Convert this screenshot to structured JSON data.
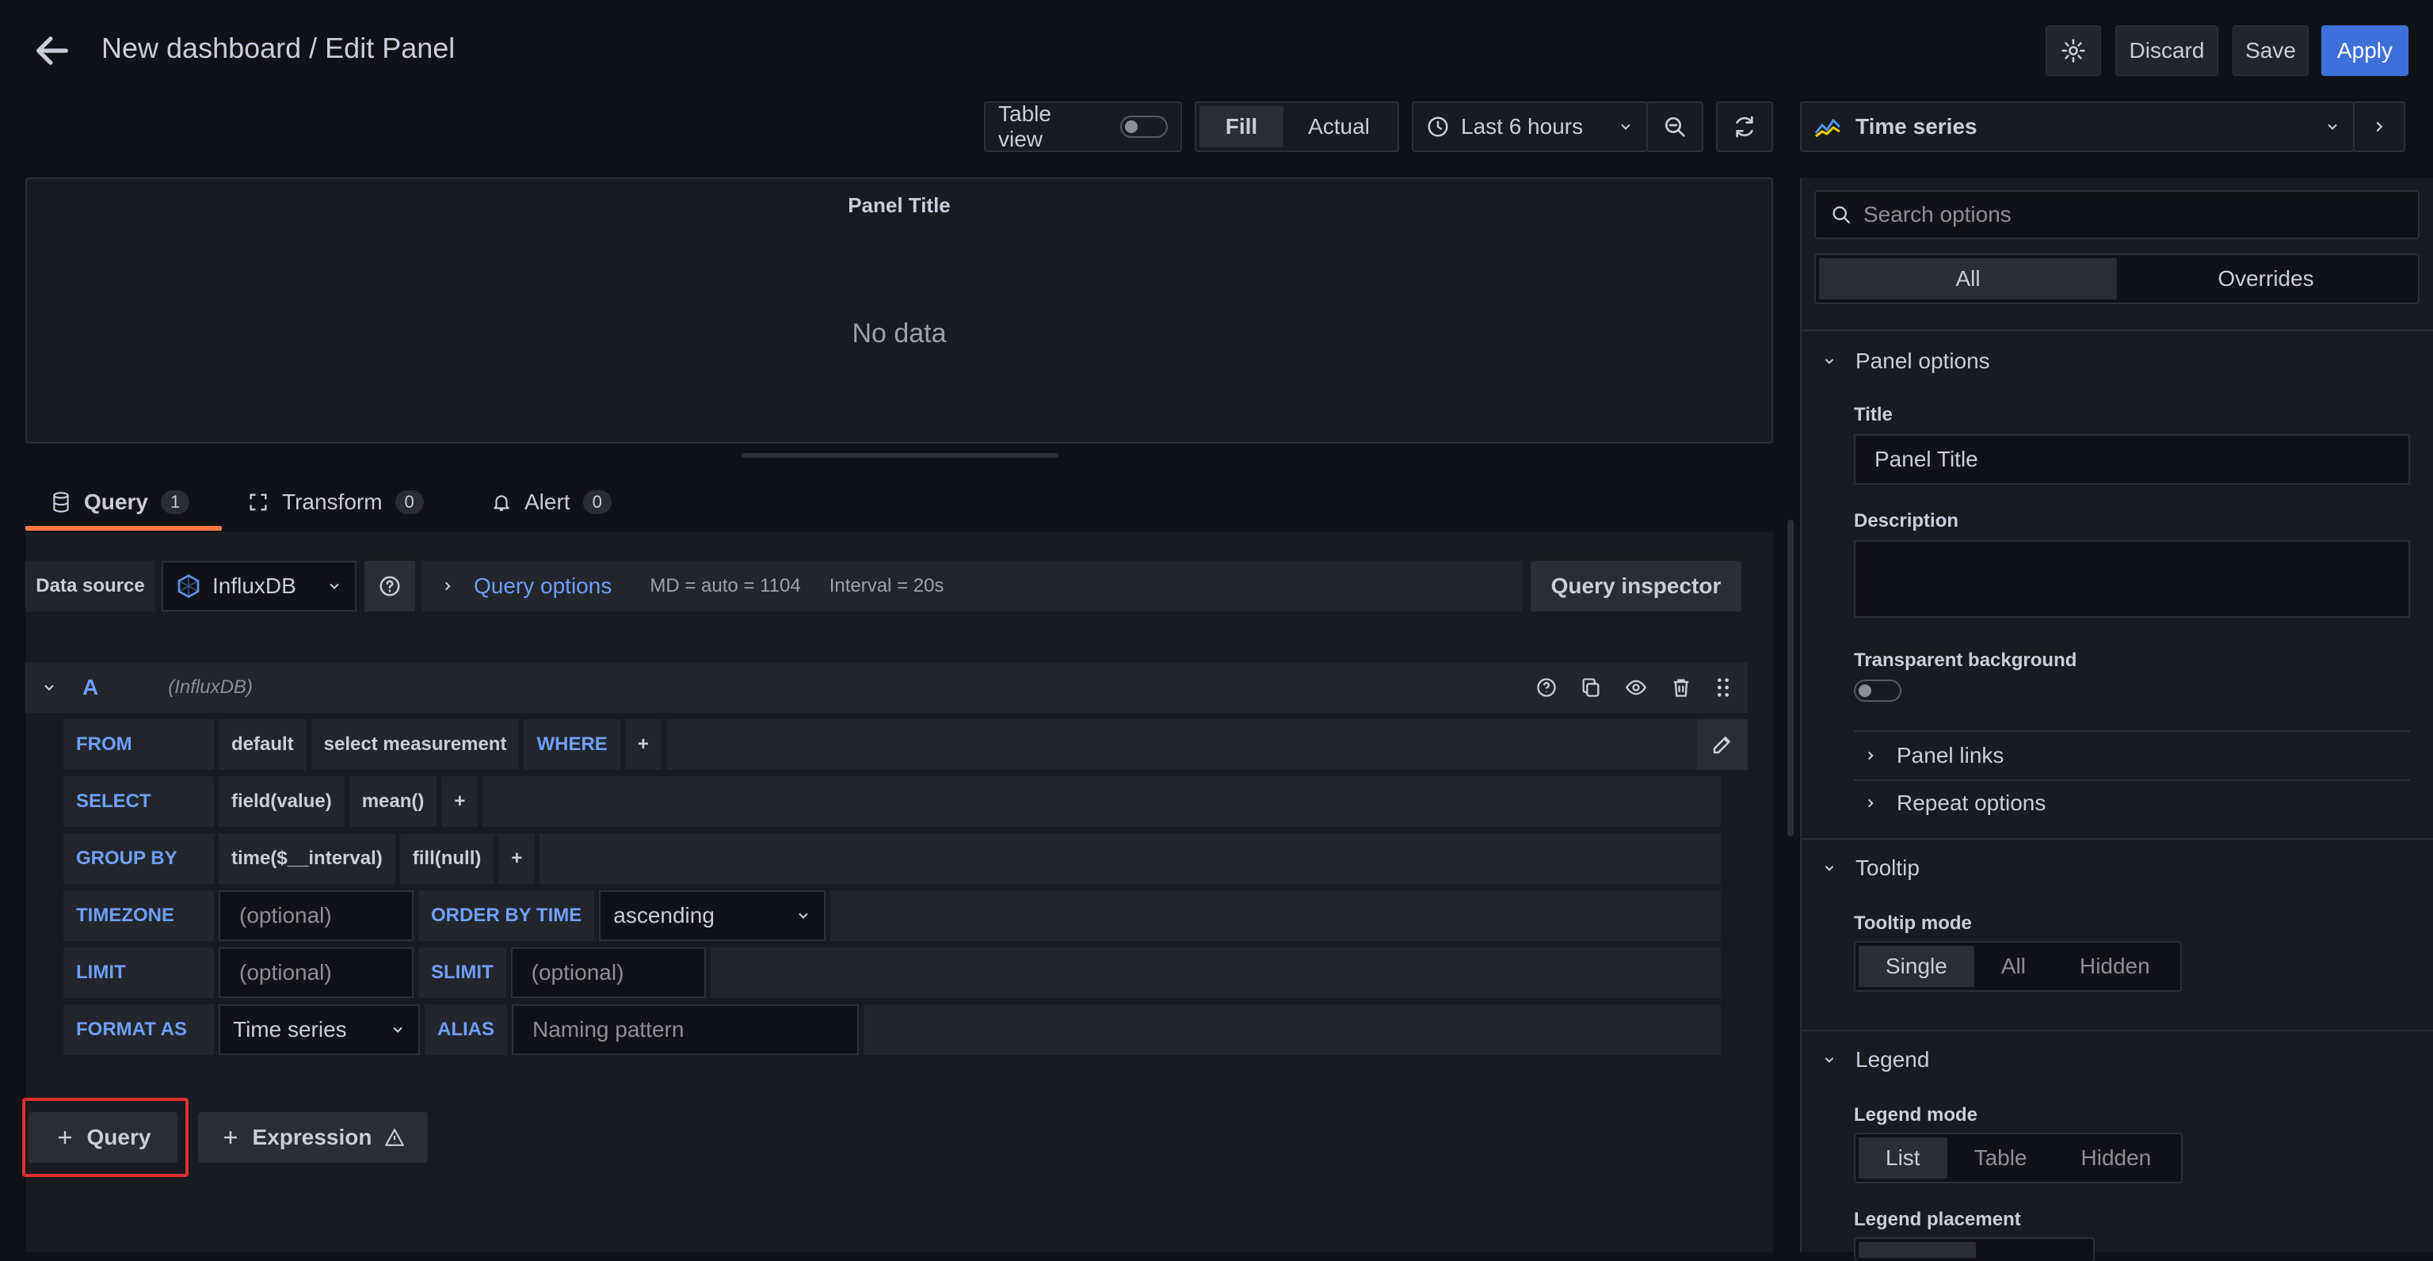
{
  "header": {
    "title": "New dashboard / Edit Panel",
    "discard_label": "Discard",
    "save_label": "Save",
    "apply_label": "Apply"
  },
  "toolbar": {
    "table_view_label": "Table view",
    "fill_label": "Fill",
    "actual_label": "Actual",
    "time_range": "Last 6 hours",
    "visualization": "Time series"
  },
  "preview": {
    "panel_title": "Panel Title",
    "empty_text": "No data"
  },
  "tabs": [
    {
      "label": "Query",
      "count": "1"
    },
    {
      "label": "Transform",
      "count": "0"
    },
    {
      "label": "Alert",
      "count": "0"
    }
  ],
  "datasource": {
    "label": "Data source",
    "name": "InfluxDB",
    "query_options_label": "Query options",
    "md": "MD = auto = 1104",
    "interval": "Interval = 20s",
    "inspector_label": "Query inspector"
  },
  "query": {
    "ref": "A",
    "source": "(InfluxDB)",
    "from": {
      "kw": "FROM",
      "policy": "default",
      "measurement": "select measurement",
      "where": "WHERE",
      "plus": "+"
    },
    "select": {
      "kw": "SELECT",
      "field": "field(value)",
      "fn": "mean()",
      "plus": "+"
    },
    "group": {
      "kw": "GROUP BY",
      "time": "time($__interval)",
      "fill": "fill(null)",
      "plus": "+"
    },
    "timezone": {
      "kw": "TIMEZONE",
      "placeholder": "(optional)",
      "order_kw": "ORDER BY TIME",
      "order_value": "ascending"
    },
    "limit": {
      "kw": "LIMIT",
      "placeholder": "(optional)",
      "slimit_kw": "SLIMIT",
      "slimit_placeholder": "(optional)"
    },
    "format": {
      "kw": "FORMAT AS",
      "value": "Time series",
      "alias_kw": "ALIAS",
      "alias_placeholder": "Naming pattern"
    }
  },
  "actions": {
    "add_query_label": "Query",
    "add_expression_label": "Expression"
  },
  "options": {
    "search_placeholder": "Search options",
    "tab_all": "All",
    "tab_overrides": "Overrides",
    "panel_options": {
      "heading": "Panel options",
      "title_label": "Title",
      "title_value": "Panel Title",
      "description_label": "Description",
      "transparent_label": "Transparent background",
      "panel_links": "Panel links",
      "repeat_options": "Repeat options"
    },
    "tooltip": {
      "heading": "Tooltip",
      "mode_label": "Tooltip mode",
      "modes": [
        "Single",
        "All",
        "Hidden"
      ],
      "selected": "Single"
    },
    "legend": {
      "heading": "Legend",
      "mode_label": "Legend mode",
      "modes": [
        "List",
        "Table",
        "Hidden"
      ],
      "selected": "List",
      "placement_label": "Legend placement"
    }
  },
  "colors": {
    "background": "#111217",
    "panel": "#181b1f",
    "accent_blue": "#3d71d9",
    "keyword_blue": "#6e9fff",
    "tab_underline": "#ff7b42",
    "highlight_red": "#e02f2f"
  }
}
